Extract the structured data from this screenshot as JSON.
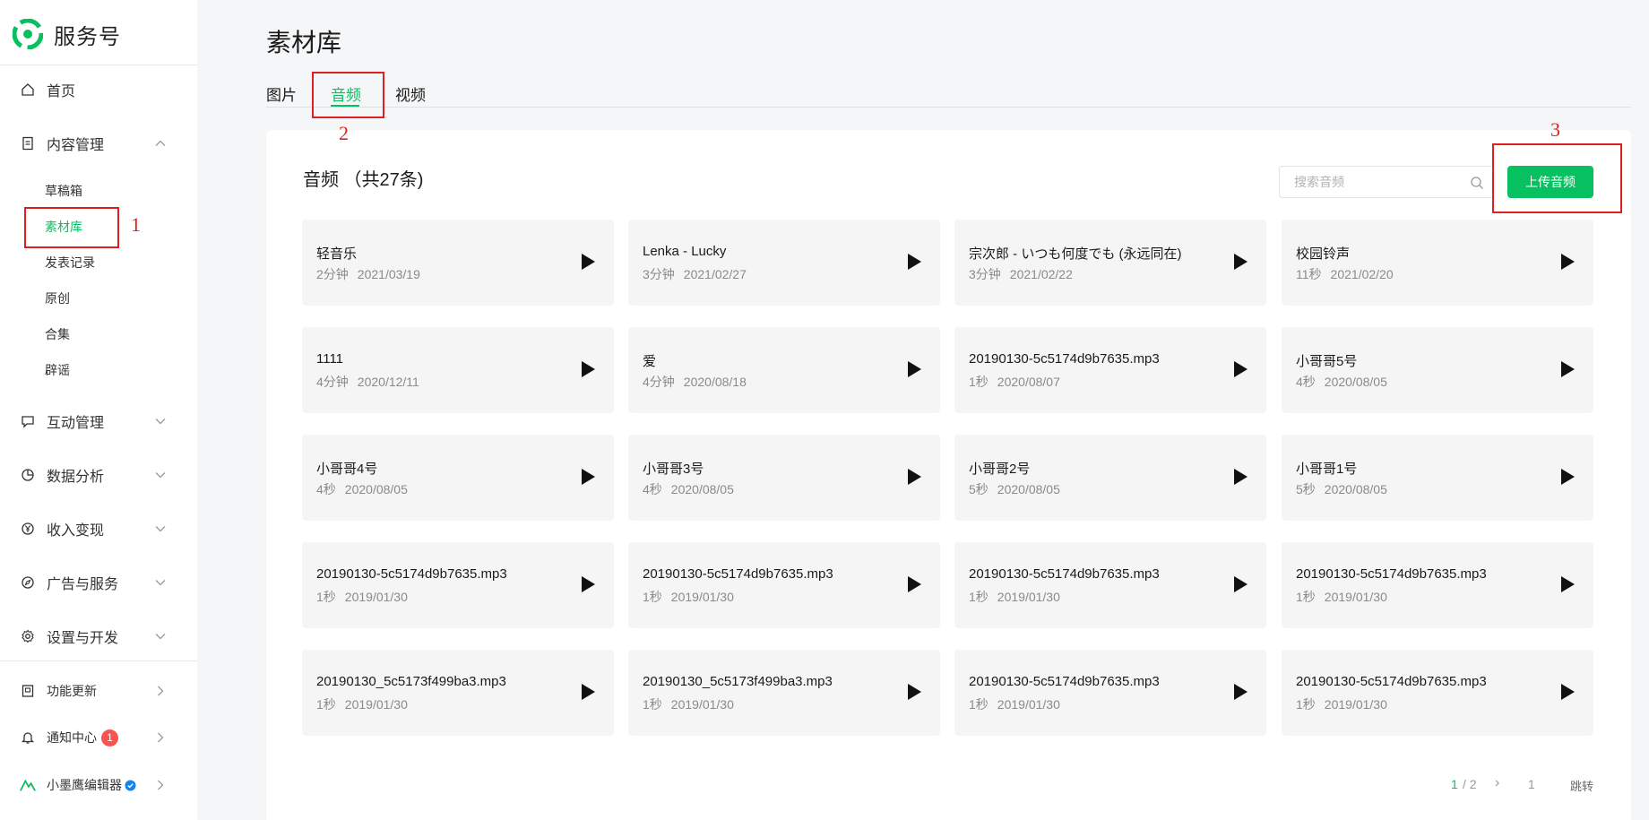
{
  "app": {
    "name": "服务号"
  },
  "sidebar": {
    "home": "首页",
    "content_mgmt": "内容管理",
    "content_sub": [
      "草稿箱",
      "素材库",
      "发表记录",
      "原创",
      "合集",
      "辟谣"
    ],
    "interaction": "互动管理",
    "analytics": "数据分析",
    "monetize": "收入变现",
    "ads": "广告与服务",
    "settings": "设置与开发",
    "updates": "功能更新",
    "notify": "通知中心",
    "notify_count": "1",
    "account": "小墨鹰编辑器"
  },
  "page": {
    "title": "素材库"
  },
  "tabs": [
    "图片",
    "音频",
    "视频"
  ],
  "panel": {
    "title": "音频 （共27条)",
    "search_placeholder": "搜索音频",
    "upload_label": "上传音频"
  },
  "cards": [
    {
      "title": "轻音乐",
      "duration": "2分钟",
      "date": "2021/03/19"
    },
    {
      "title": "Lenka - Lucky",
      "duration": "3分钟",
      "date": "2021/02/27"
    },
    {
      "title": "宗次郎 - いつも何度でも (永远同在)",
      "duration": "3分钟",
      "date": "2021/02/22"
    },
    {
      "title": "校园铃声",
      "duration": "11秒",
      "date": "2021/02/20"
    },
    {
      "title": "1111",
      "duration": "4分钟",
      "date": "2020/12/11"
    },
    {
      "title": "爱",
      "duration": "4分钟",
      "date": "2020/08/18"
    },
    {
      "title": "20190130-5c5174d9b7635.mp3",
      "duration": "1秒",
      "date": "2020/08/07"
    },
    {
      "title": "小哥哥5号",
      "duration": "4秒",
      "date": "2020/08/05"
    },
    {
      "title": "小哥哥4号",
      "duration": "4秒",
      "date": "2020/08/05"
    },
    {
      "title": "小哥哥3号",
      "duration": "4秒",
      "date": "2020/08/05"
    },
    {
      "title": "小哥哥2号",
      "duration": "5秒",
      "date": "2020/08/05"
    },
    {
      "title": "小哥哥1号",
      "duration": "5秒",
      "date": "2020/08/05"
    },
    {
      "title": "20190130-5c5174d9b7635.mp3",
      "duration": "1秒",
      "date": "2019/01/30"
    },
    {
      "title": "20190130-5c5174d9b7635.mp3",
      "duration": "1秒",
      "date": "2019/01/30"
    },
    {
      "title": "20190130-5c5174d9b7635.mp3",
      "duration": "1秒",
      "date": "2019/01/30"
    },
    {
      "title": "20190130-5c5174d9b7635.mp3",
      "duration": "1秒",
      "date": "2019/01/30"
    },
    {
      "title": "20190130_5c5173f499ba3.mp3",
      "duration": "1秒",
      "date": "2019/01/30"
    },
    {
      "title": "20190130_5c5173f499ba3.mp3",
      "duration": "1秒",
      "date": "2019/01/30"
    },
    {
      "title": "20190130-5c5174d9b7635.mp3",
      "duration": "1秒",
      "date": "2019/01/30"
    },
    {
      "title": "20190130-5c5174d9b7635.mp3",
      "duration": "1秒",
      "date": "2019/01/30"
    }
  ],
  "pagination": {
    "current": "1",
    "total": "/ 2",
    "next_symbol": "›",
    "page_input": "1",
    "jump": "跳转"
  },
  "annotations": [
    "1",
    "2",
    "3"
  ],
  "colors": {
    "accent": "#07c160",
    "annotation": "#e02020",
    "badge": "#fa5151"
  }
}
